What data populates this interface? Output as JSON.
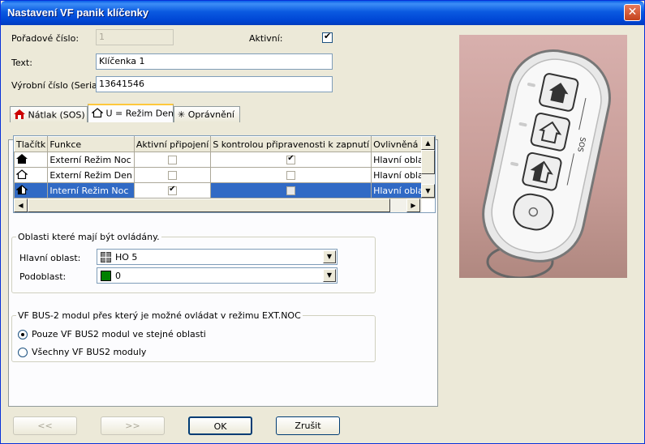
{
  "window": {
    "title": "Nastavení VF panik klíčenky",
    "close": "✕"
  },
  "fields": {
    "order_label": "Pořadové číslo:",
    "order_value": "1",
    "active_label": "Aktivní:",
    "text_label": "Text:",
    "text_value": "Klíčenka 1",
    "serial_label": "Výrobní číslo (Serial N",
    "serial_value": "13641546"
  },
  "tabs": [
    {
      "label": "Nátlak (SOS)",
      "icon": "house-red-icon"
    },
    {
      "label": "U = Režim Den",
      "icon": "house-outline-icon"
    },
    {
      "label": "Oprávnění",
      "icon": "sparkle-icon"
    }
  ],
  "grid": {
    "columns": [
      "Tlačítk",
      "Funkce",
      "Aktivní připojení",
      "S kontrolou připravenosti k zapnutí",
      "Ovlivněná oblast"
    ],
    "rows": [
      {
        "icon": "house-filled-icon",
        "function": "Externí Režim Noc",
        "active": false,
        "check": true,
        "area": "Hlavní oblast"
      },
      {
        "icon": "house-outline-icon",
        "function": "Externí Režim Den",
        "active": false,
        "check": false,
        "area": "Hlavní oblast"
      },
      {
        "icon": "house-half-icon",
        "function": "Interní Režim Noc",
        "active": true,
        "check": false,
        "area": "Hlavní oblast"
      }
    ]
  },
  "areas": {
    "title": "Oblasti které mají být ovládány.",
    "main_label": "Hlavní oblast:",
    "main_value": "HO 5",
    "sub_label": "Podoblast:",
    "sub_value": "0",
    "sub_color": "#008000"
  },
  "bus": {
    "title": "VF BUS-2 modul přes který je možné ovládat v režimu EXT.NOC",
    "opt1": "Pouze VF BUS2 modul ve stejné oblasti",
    "opt2": "Všechny VF BUS2 moduly"
  },
  "buttons": {
    "prev": "<<",
    "next": ">>",
    "ok": "OK",
    "cancel": "Zrušit"
  },
  "photo": {
    "sos_text": "SOS"
  }
}
